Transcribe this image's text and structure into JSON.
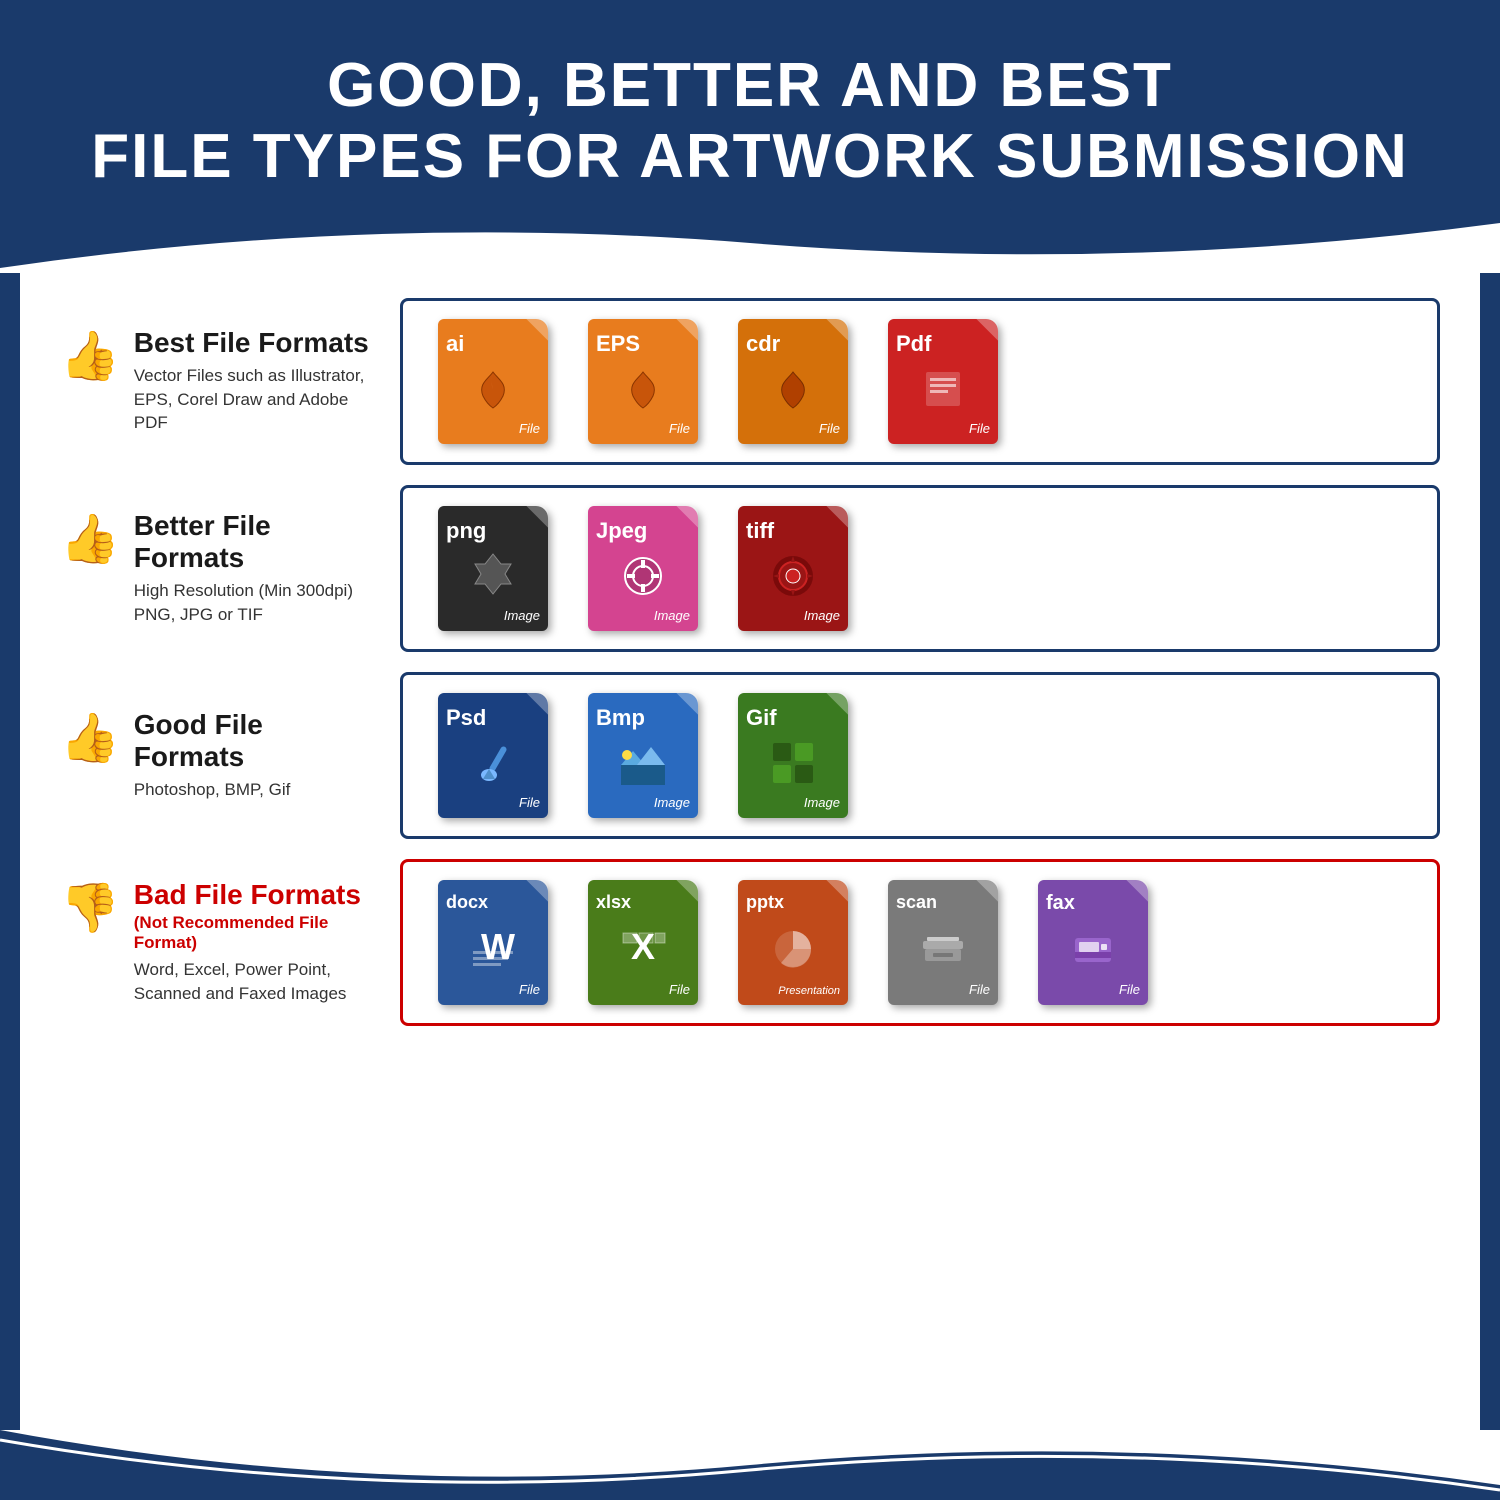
{
  "header": {
    "title_line1": "GOOD, BETTER AND BEST",
    "title_line2": "FILE TYPES FOR ARTWORK SUBMISSION"
  },
  "rows": [
    {
      "id": "best",
      "thumb": "up",
      "title": "Best File Formats",
      "subtitle": "Vector Files such as Illustrator,\nEPS, Corel Draw and Adobe PDF",
      "box_type": "normal",
      "files": [
        {
          "ext": "ai",
          "color": "orange",
          "icon": "pen",
          "label": "File"
        },
        {
          "ext": "EPS",
          "color": "orange",
          "icon": "pen",
          "label": "File"
        },
        {
          "ext": "cdr",
          "color": "orange-dark",
          "icon": "pen",
          "label": "File"
        },
        {
          "ext": "Pdf",
          "color": "red-file",
          "icon": "doc",
          "label": "File"
        }
      ]
    },
    {
      "id": "better",
      "thumb": "up",
      "title": "Better File Formats",
      "subtitle": "High Resolution (Min 300dpi)\nPNG, JPG or TIF",
      "box_type": "normal",
      "files": [
        {
          "ext": "png",
          "color": "black",
          "icon": "star",
          "label": "Image"
        },
        {
          "ext": "Jpeg",
          "color": "pink",
          "icon": "camera",
          "label": "Image"
        },
        {
          "ext": "tiff",
          "color": "dark-red",
          "icon": "gear",
          "label": "Image"
        }
      ]
    },
    {
      "id": "good",
      "thumb": "up",
      "title": "Good File Formats",
      "subtitle": "Photoshop, BMP, Gif",
      "box_type": "normal",
      "files": [
        {
          "ext": "Psd",
          "color": "dark-blue",
          "icon": "brush",
          "label": "File"
        },
        {
          "ext": "Bmp",
          "color": "blue",
          "icon": "landscape",
          "label": "Image"
        },
        {
          "ext": "Gif",
          "color": "green-file",
          "icon": "grid",
          "label": "Image"
        }
      ]
    },
    {
      "id": "bad",
      "thumb": "down",
      "title": "Bad File Formats",
      "subtitle_red": "(Not Recommended File Format)",
      "subtitle": "Word, Excel, Power Point,\nScanned and Faxed Images",
      "box_type": "bad",
      "files": [
        {
          "ext": "docx",
          "color": "word-blue",
          "icon": "W",
          "label": "File"
        },
        {
          "ext": "xlsx",
          "color": "excel-green",
          "icon": "X",
          "label": "File"
        },
        {
          "ext": "pptx",
          "color": "pptx-orange",
          "icon": "chart",
          "label": "Presentation"
        },
        {
          "ext": "scan",
          "color": "scan-gray",
          "icon": "scanner",
          "label": "File"
        },
        {
          "ext": "fax",
          "color": "fax-purple",
          "icon": "fax",
          "label": "File"
        }
      ]
    }
  ],
  "colors": {
    "header_bg": "#1a3a6b",
    "border_normal": "#1a3a6b",
    "border_bad": "#cc0000",
    "bad_title_color": "#cc0000"
  }
}
